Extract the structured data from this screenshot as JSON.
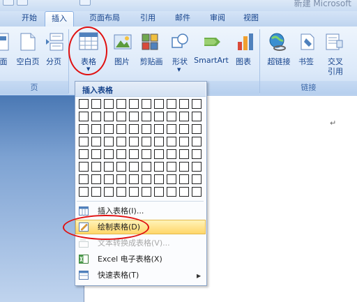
{
  "window": {
    "title": "新建 Microsoft"
  },
  "tabs": [
    {
      "label": "开始"
    },
    {
      "label": "插入",
      "active": true
    },
    {
      "label": "页面布局"
    },
    {
      "label": "引用"
    },
    {
      "label": "邮件"
    },
    {
      "label": "审阅"
    },
    {
      "label": "视图"
    }
  ],
  "ribbon": {
    "pages_group": {
      "label": "页",
      "buttons": [
        {
          "label": "面",
          "icon": "cover-page-icon"
        },
        {
          "label": "空白页",
          "icon": "blank-page-icon"
        },
        {
          "label": "分页",
          "icon": "page-break-icon"
        }
      ]
    },
    "table_button": {
      "label": "表格",
      "icon": "table-icon"
    },
    "illustrations": [
      {
        "label": "图片",
        "icon": "picture-icon"
      },
      {
        "label": "剪贴画",
        "icon": "clipart-icon"
      },
      {
        "label": "形状",
        "icon": "shapes-icon"
      },
      {
        "label": "SmartArt",
        "icon": "smartart-icon"
      },
      {
        "label": "图表",
        "icon": "chart-icon"
      }
    ],
    "links_group": {
      "label": "链接",
      "buttons": [
        {
          "label": "超链接",
          "icon": "hyperlink-icon"
        },
        {
          "label": "书签",
          "icon": "bookmark-icon"
        },
        {
          "label": "交叉",
          "label2": "引用",
          "icon": "cross-reference-icon"
        }
      ]
    }
  },
  "dropdown": {
    "header": "插入表格",
    "grid": {
      "columns": 10,
      "rows": 8
    },
    "items": [
      {
        "label": "插入表格(I)...",
        "icon": "insert-table-icon"
      },
      {
        "label": "绘制表格(D)",
        "icon": "draw-table-icon",
        "highlighted": true
      },
      {
        "label": "文本转换成表格(V)...",
        "icon": "text-to-table-icon",
        "disabled": true
      },
      {
        "label": "Excel 电子表格(X)",
        "icon": "excel-sheet-icon"
      },
      {
        "label": "快速表格(T)",
        "icon": "quick-tables-icon",
        "submenu": true
      }
    ]
  },
  "document": {
    "paragraph_mark": "↵"
  },
  "colors": {
    "ribbon_text": "#15428b",
    "highlight": "#ffd66a",
    "annotation": "#e01010"
  }
}
